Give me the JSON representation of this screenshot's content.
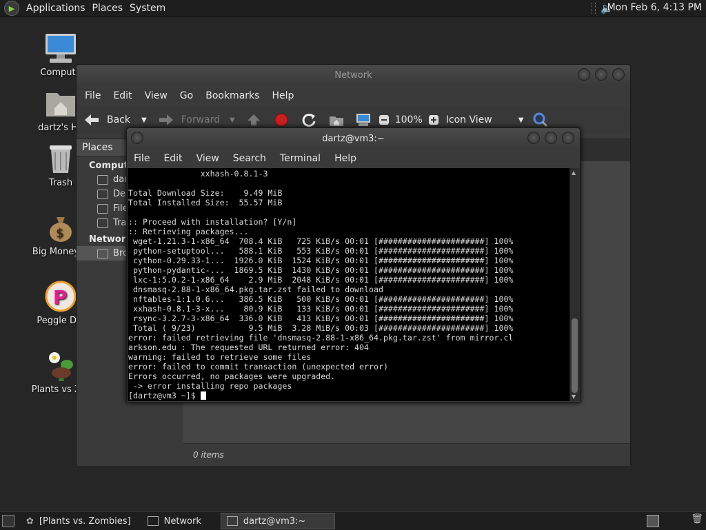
{
  "top_panel": {
    "menus": [
      "Applications",
      "Places",
      "System"
    ],
    "clock": "Mon Feb  6, 4:13 PM"
  },
  "desktop_icons": [
    {
      "label": "Compute",
      "icon": "computer-icon"
    },
    {
      "label": "dartz's Ho",
      "icon": "home-folder-icon"
    },
    {
      "label": "Trash",
      "icon": "trash-icon"
    },
    {
      "label": "Big Money D",
      "icon": "money-bag-icon"
    },
    {
      "label": "Peggle Del",
      "icon": "peggle-icon"
    },
    {
      "label": "Plants vs Zor",
      "icon": "plants-icon"
    }
  ],
  "nautilus": {
    "title": "Network",
    "menus": [
      "File",
      "Edit",
      "View",
      "Go",
      "Bookmarks",
      "Help"
    ],
    "toolbar": {
      "back": "Back",
      "forward": "Forward",
      "zoom": "100%",
      "view_mode": "Icon View"
    },
    "sidebar": {
      "header": "Places",
      "sections": [
        {
          "title": "Compute",
          "items": [
            "dar",
            "Des",
            "File",
            "Tra"
          ]
        },
        {
          "title": "Network",
          "items": [
            "Bro"
          ]
        }
      ]
    },
    "status": "0 items"
  },
  "terminal": {
    "title": "dartz@vm3:~",
    "menus": [
      "File",
      "Edit",
      "View",
      "Search",
      "Terminal",
      "Help"
    ],
    "lines": [
      "               xxhash-0.8.1-3",
      "",
      "Total Download Size:    9.49 MiB",
      "Total Installed Size:  55.57 MiB",
      "",
      ":: Proceed with installation? [Y/n]",
      ":: Retrieving packages...",
      " wget-1.21.3-1-x86_64  708.4 KiB   725 KiB/s 00:01 [######################] 100%",
      " python-setuptool...   588.1 KiB   553 KiB/s 00:01 [######################] 100%",
      " cython-0.29.33-1...  1926.0 KiB  1524 KiB/s 00:01 [######################] 100%",
      " python-pydantic-...  1869.5 KiB  1430 KiB/s 00:01 [######################] 100%",
      " lxc-1:5.0.2-1-x86_64    2.9 MiB  2048 KiB/s 00:01 [######################] 100%",
      " dnsmasq-2.88-1-x86_64.pkg.tar.zst failed to download",
      " nftables-1:1.0.6...   386.5 KiB   500 KiB/s 00:01 [######################] 100%",
      " xxhash-0.8.1-3-x...    80.9 KiB   133 KiB/s 00:01 [######################] 100%",
      " rsync-3.2.7-3-x86_64  336.0 KiB   413 KiB/s 00:01 [######################] 100%",
      " Total ( 9/23)           9.5 MiB  3.28 MiB/s 00:03 [######################] 100%",
      "error: failed retrieving file 'dnsmasq-2.88-1-x86_64.pkg.tar.zst' from mirror.cl",
      "arkson.edu : The requested URL returned error: 404",
      "warning: failed to retrieve some files",
      "error: failed to commit transaction (unexpected error)",
      "Errors occurred, no packages were upgraded.",
      " -> error installing repo packages"
    ],
    "prompt": "[dartz@vm3 ~]$ "
  },
  "taskbar": {
    "tasks": [
      "[Plants vs. Zombies]",
      "Network",
      "dartz@vm3:~"
    ]
  }
}
